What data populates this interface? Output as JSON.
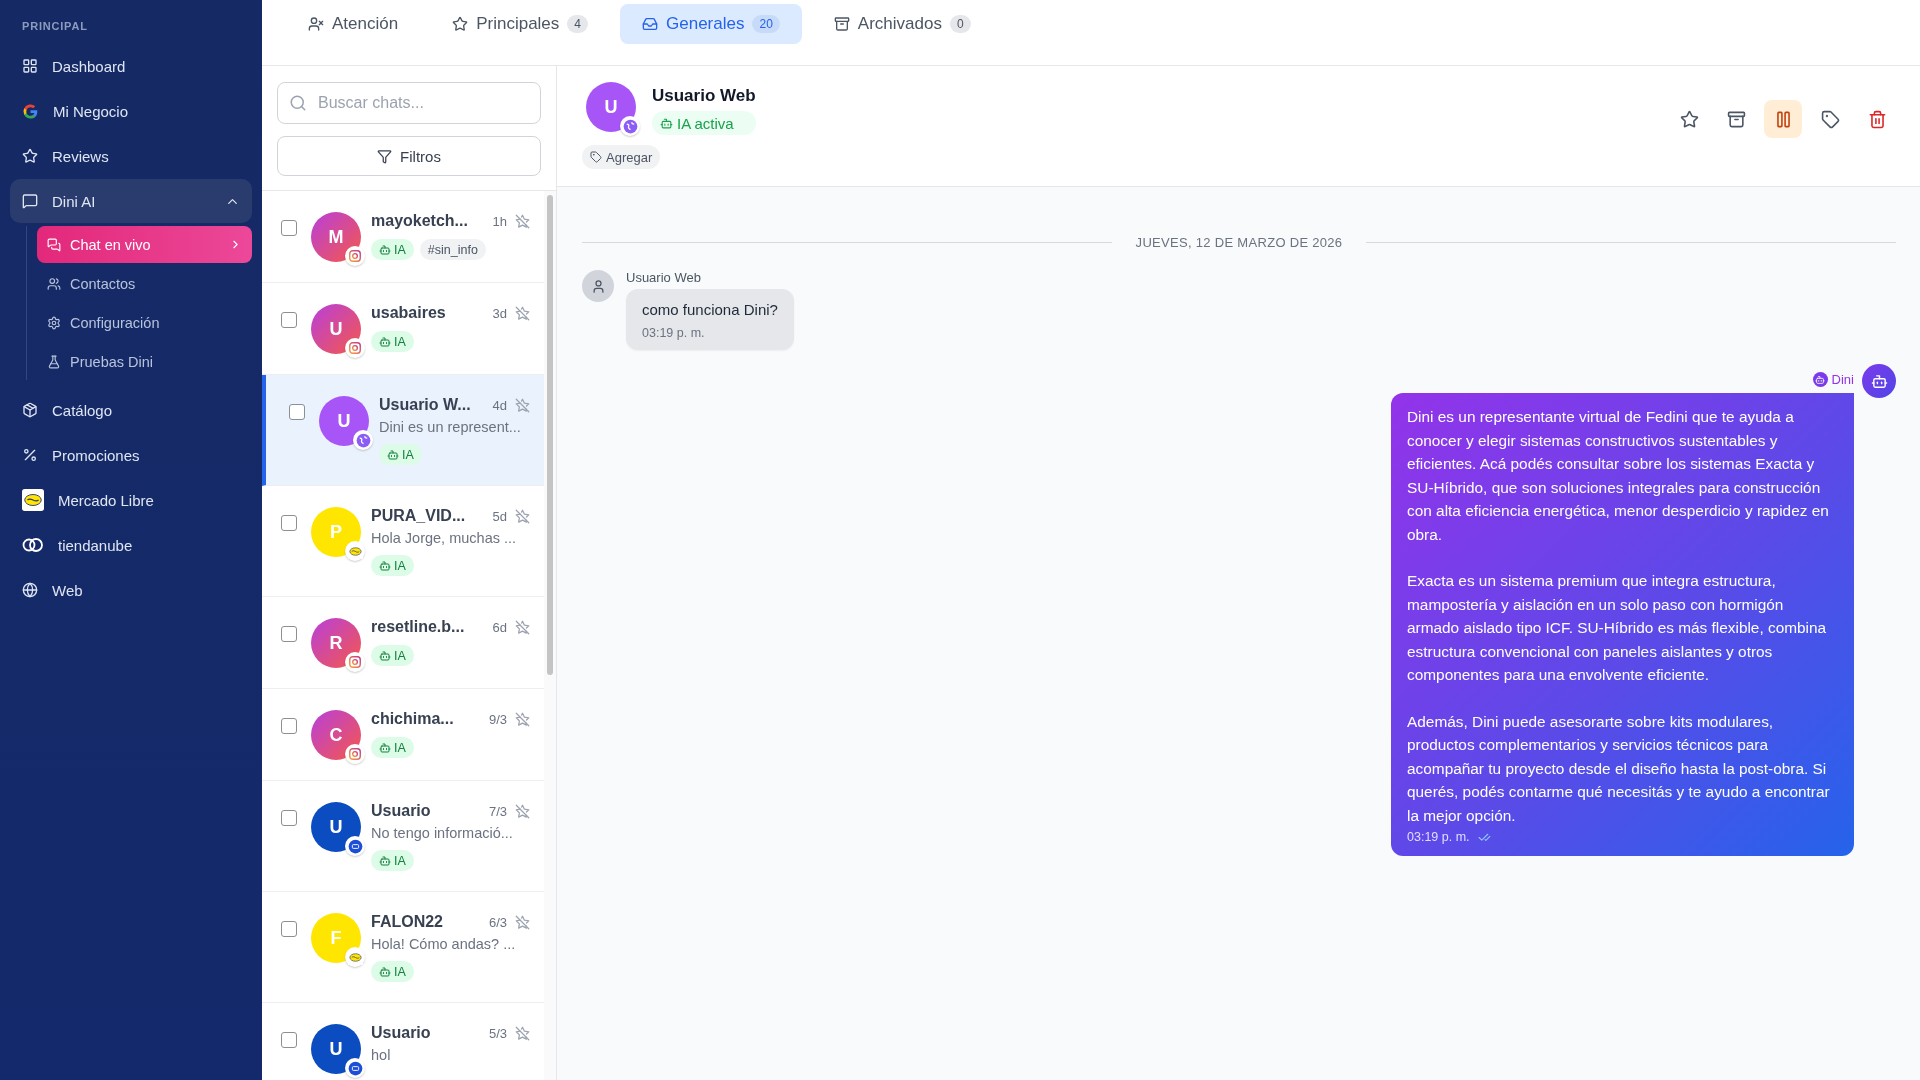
{
  "sidebar": {
    "section": "PRINCIPAL",
    "items": [
      {
        "label": "Dashboard",
        "selected": false
      },
      {
        "label": "Mi Negocio",
        "selected": false
      },
      {
        "label": "Reviews",
        "selected": false
      },
      {
        "label": "Dini AI",
        "selected": true,
        "expanded": true,
        "children": [
          {
            "label": "Chat en vivo",
            "selected": true
          },
          {
            "label": "Contactos",
            "selected": false
          },
          {
            "label": "Configuración",
            "selected": false
          },
          {
            "label": "Pruebas Dini",
            "selected": false
          }
        ]
      },
      {
        "label": "Catálogo",
        "selected": false
      },
      {
        "label": "Promociones",
        "selected": false
      },
      {
        "label": "Mercado Libre",
        "selected": false
      },
      {
        "label": "tiendanube",
        "selected": false
      },
      {
        "label": "Web",
        "selected": false
      }
    ]
  },
  "tabs": [
    {
      "label": "Atención",
      "selected": false
    },
    {
      "label": "Principales",
      "count": "4",
      "selected": false
    },
    {
      "label": "Generales",
      "count": "20",
      "selected": true
    },
    {
      "label": "Archivados",
      "count": "0",
      "selected": false
    }
  ],
  "chat_list": {
    "search": {
      "placeholder": "Buscar chats..."
    },
    "filter_button": "Filtros",
    "chats": [
      {
        "initial": "M",
        "kind": "instagram",
        "name": "mayoketch...",
        "time": "1h",
        "checked": false,
        "selected": false,
        "tags": [
          {
            "kind": "ai",
            "label": "IA"
          },
          {
            "kind": "hashtag",
            "label": "#sin_info"
          }
        ]
      },
      {
        "initial": "U",
        "kind": "instagram",
        "name": "usabaires",
        "time": "3d",
        "checked": false,
        "selected": false,
        "tags": [
          {
            "kind": "ai",
            "label": "IA"
          }
        ]
      },
      {
        "initial": "U",
        "kind": "web",
        "name": "Usuario W...",
        "time": "4d",
        "preview": "Dini es un represent...",
        "checked": false,
        "selected": true,
        "tags": [
          {
            "kind": "ai",
            "label": "IA"
          }
        ]
      },
      {
        "initial": "P",
        "kind": "mercadolibre",
        "name": "PURA_VID...",
        "time": "5d",
        "preview": "Hola Jorge, muchas ...",
        "checked": false,
        "selected": false,
        "tags": [
          {
            "kind": "ai",
            "label": "IA"
          }
        ]
      },
      {
        "initial": "R",
        "kind": "instagram",
        "name": "resetline.b...",
        "time": "6d",
        "checked": false,
        "selected": false,
        "tags": [
          {
            "kind": "ai",
            "label": "IA"
          }
        ]
      },
      {
        "initial": "C",
        "kind": "instagram",
        "name": "chichima...",
        "time": "9/3",
        "checked": false,
        "selected": false,
        "tags": [
          {
            "kind": "ai",
            "label": "IA"
          }
        ]
      },
      {
        "initial": "U",
        "kind": "widget",
        "name": "Usuario",
        "time": "7/3",
        "preview": "No tengo informació...",
        "checked": false,
        "selected": false,
        "tags": [
          {
            "kind": "ai",
            "label": "IA"
          }
        ]
      },
      {
        "initial": "F",
        "kind": "mercadolibre",
        "name": "FALON22",
        "time": "6/3",
        "preview": "Hola! Cómo andas? ...",
        "checked": false,
        "selected": false,
        "tags": [
          {
            "kind": "ai",
            "label": "IA"
          }
        ]
      },
      {
        "initial": "U",
        "kind": "widget",
        "name": "Usuario",
        "time": "5/3",
        "preview": "hol",
        "checked": false,
        "selected": false
      }
    ]
  },
  "conversation": {
    "initial": "U",
    "kind": "web",
    "name": "Usuario Web",
    "status": "IA activa",
    "add_tag": "Agregar",
    "actions": [
      {
        "kind": "star",
        "active": false
      },
      {
        "kind": "archive",
        "active": false
      },
      {
        "kind": "pause",
        "active": true
      },
      {
        "kind": "tag",
        "active": false
      },
      {
        "kind": "delete",
        "active": false
      }
    ],
    "date": "JUEVES, 12 DE MARZO DE 2026",
    "messages": [
      {
        "kind": "incoming",
        "sender": "Usuario Web",
        "paragraphs": [
          "como funciona Dini?"
        ],
        "time": "03:19 p. m."
      },
      {
        "kind": "outgoing",
        "sender": "Dini",
        "paragraphs": [
          "Dini es un representante virtual de Fedini que te ayuda a conocer y elegir sistemas constructivos sustentables y eficientes. Acá podés consultar sobre los sistemas Exacta y SU-Híbrido, que son soluciones integrales para construcción con alta eficiencia energética, menor desperdicio y rapidez en obra.",
          "Exacta es un sistema premium que integra estructura, mampostería y aislación en un solo paso con hormigón armado aislado tipo ICF. SU-Híbrido es más flexible, combina estructura convencional con paneles aislantes y otros componentes para una envolvente eficiente.",
          "Además, Dini puede asesorarte sobre kits modulares, productos complementarios y servicios técnicos para acompañar tu proyecto desde el diseño hasta la post-obra. Si querés, podés contarme qué necesitás y te ayudo a encontrar la mejor opción."
        ],
        "time": "03:19 p. m.",
        "read": true
      }
    ]
  }
}
